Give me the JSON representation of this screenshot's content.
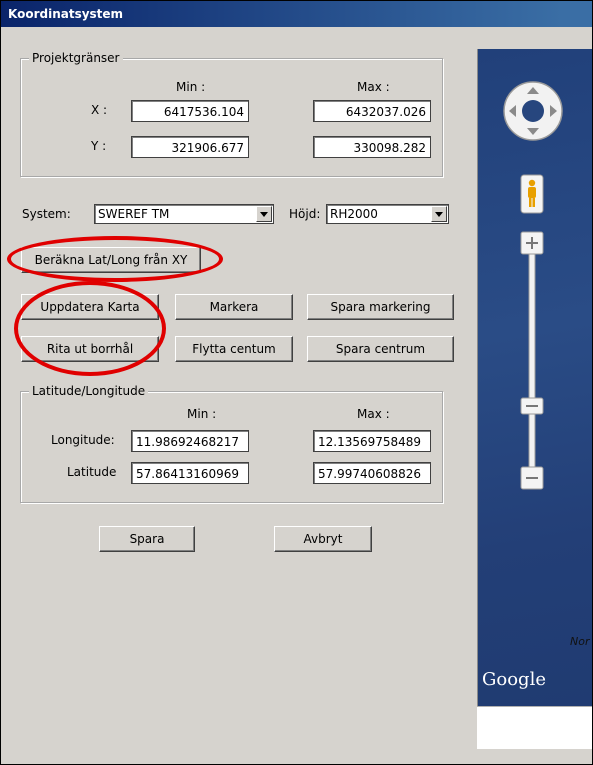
{
  "window": {
    "title": "Koordinatsystem"
  },
  "project_bounds": {
    "legend": "Projektgränser",
    "min_label": "Min :",
    "max_label": "Max :",
    "x_label": "X :",
    "y_label": "Y :",
    "x_min": "6417536.104",
    "x_max": "6432037.026",
    "y_min": "321906.677",
    "y_max": "330098.282"
  },
  "system": {
    "system_label": "System:",
    "system_value": "SWEREF TM",
    "height_label": "Höjd:",
    "height_value": "RH2000"
  },
  "buttons": {
    "calc_latlong": "Beräkna Lat/Long från XY",
    "update_map": "Uppdatera Karta",
    "mark": "Markera",
    "save_mark": "Spara markering",
    "draw_boreholes": "Rita ut borrhål",
    "move_center": "Flytta centum",
    "save_center": "Spara centrum",
    "save": "Spara",
    "cancel": "Avbryt"
  },
  "latlong": {
    "legend": "Latitude/Longitude",
    "min_label": "Min :",
    "max_label": "Max :",
    "lon_label": "Longitude:",
    "lat_label": "Latitude",
    "lon_min": "11.98692468217",
    "lon_max": "12.13569758489",
    "lat_min": "57.86413160969",
    "lat_max": "57.99740608826"
  },
  "map": {
    "logo": "Google",
    "partial_label": "Nor",
    "water_color": "#27467e"
  },
  "annotations": {
    "ring_color": "#e00000"
  }
}
